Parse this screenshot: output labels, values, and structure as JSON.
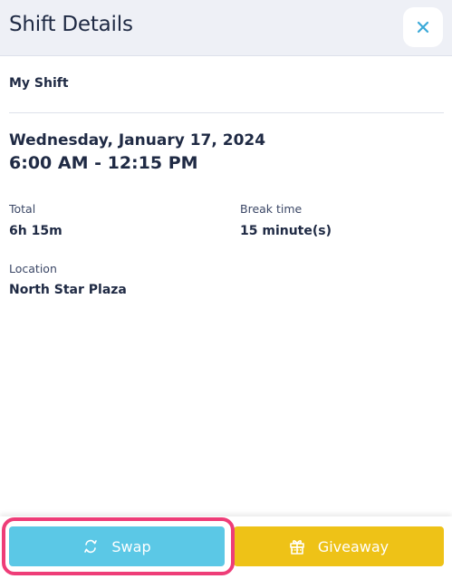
{
  "header": {
    "title": "Shift Details",
    "close_icon": "close-icon"
  },
  "shift": {
    "name": "My Shift",
    "date": "Wednesday, January 17, 2024",
    "time_range": "6:00 AM - 12:15 PM"
  },
  "details": {
    "total_label": "Total",
    "total_value": "6h 15m",
    "break_label": "Break time",
    "break_value": "15 minute(s)",
    "location_label": "Location",
    "location_value": "North Star Plaza"
  },
  "actions": {
    "swap_label": "Swap",
    "swap_icon": "swap-arrows-icon",
    "giveaway_label": "Giveaway",
    "giveaway_icon": "gift-icon"
  },
  "colors": {
    "header_bg": "#eef0f6",
    "close_x": "#3aa9d8",
    "swap_bg": "#5bc8e6",
    "giveaway_bg": "#eec217",
    "highlight": "#ee3d78",
    "text": "#1f2a44"
  }
}
